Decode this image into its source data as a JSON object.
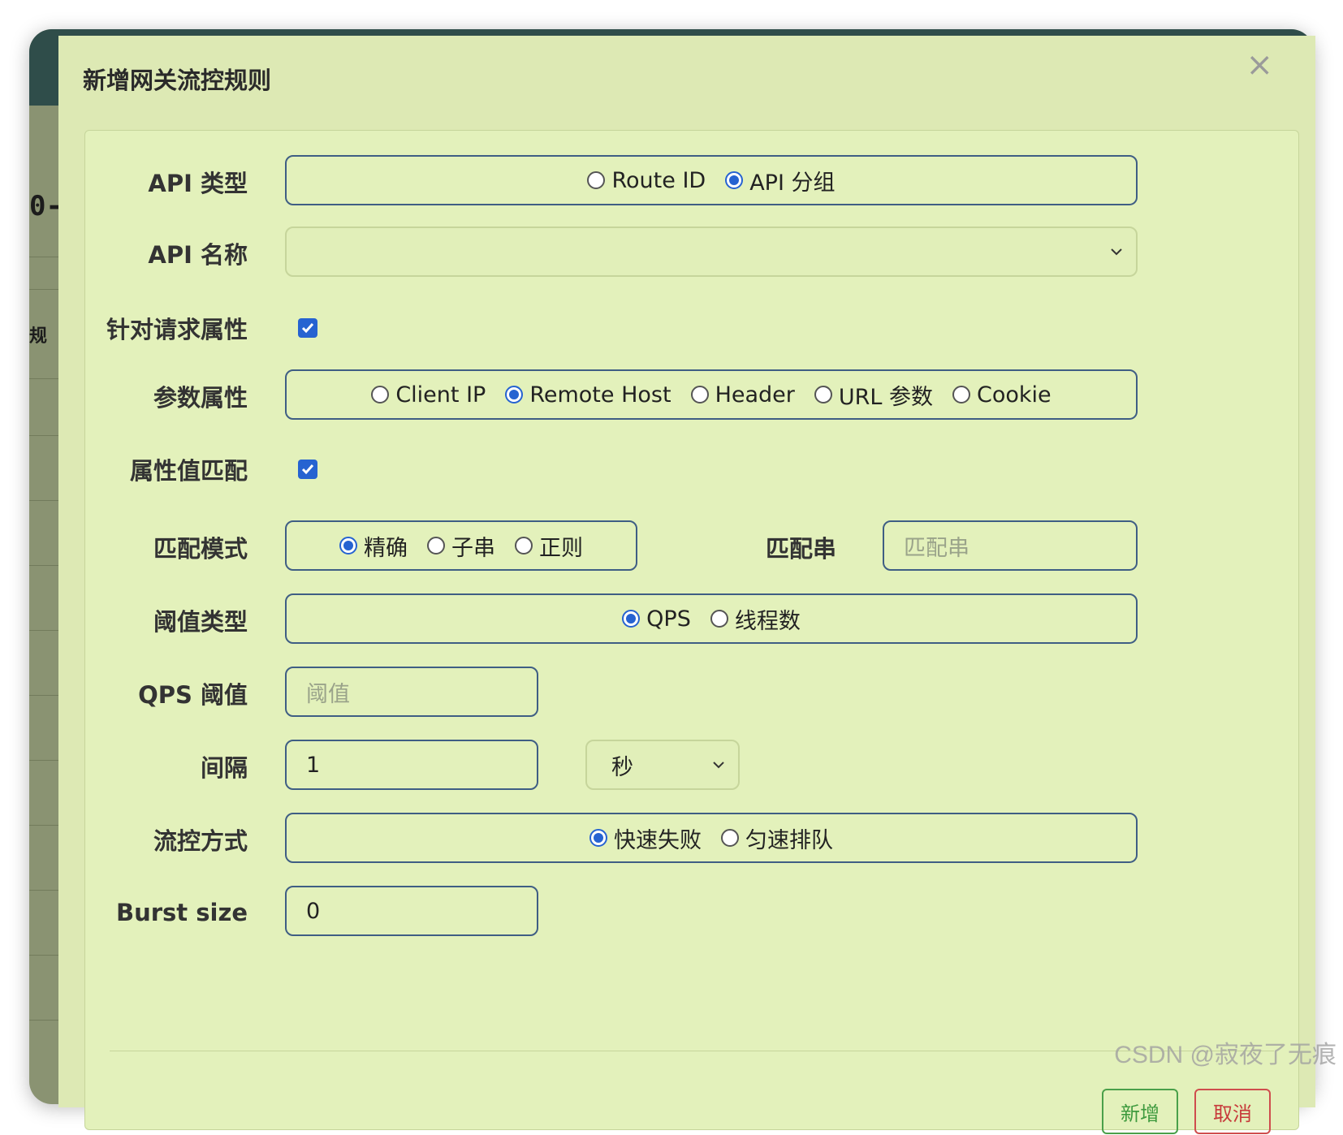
{
  "background": {
    "fragment_1": "0-",
    "fragment_2": "规"
  },
  "modal": {
    "title": "新增网关流控规则",
    "close_glyph": "×"
  },
  "form": {
    "api_type": {
      "label": "API 类型",
      "options": [
        "Route ID",
        "API 分组"
      ],
      "selected": "API 分组"
    },
    "api_name": {
      "label": "API 名称",
      "value": ""
    },
    "request_attr": {
      "label": "针对请求属性",
      "checked": true
    },
    "param_attr": {
      "label": "参数属性",
      "options": [
        "Client IP",
        "Remote Host",
        "Header",
        "URL 参数",
        "Cookie"
      ],
      "selected": "Remote Host"
    },
    "attr_match": {
      "label": "属性值匹配",
      "checked": true
    },
    "match_mode": {
      "label": "匹配模式",
      "options": [
        "精确",
        "子串",
        "正则"
      ],
      "selected": "精确",
      "pattern_label": "匹配串",
      "pattern_placeholder": "匹配串"
    },
    "threshold_type": {
      "label": "阈值类型",
      "options": [
        "QPS",
        "线程数"
      ],
      "selected": "QPS"
    },
    "qps_threshold": {
      "label": "QPS 阈值",
      "placeholder": "阈值"
    },
    "interval": {
      "label": "间隔",
      "value": "1",
      "unit": "秒"
    },
    "control_behavior": {
      "label": "流控方式",
      "options": [
        "快速失败",
        "匀速排队"
      ],
      "selected": "快速失败"
    },
    "burst_size": {
      "label": "Burst size",
      "value": "0"
    }
  },
  "footer": {
    "add_label": "新增",
    "cancel_label": "取消"
  },
  "watermark": "CSDN @寂夜了无痕",
  "colors": {
    "accent": "#2663d1",
    "field_border": "#3f5e84",
    "modal_bg": "#dde9b4",
    "add_green": "#3e9a3e",
    "cancel_red": "#c73b3b"
  }
}
